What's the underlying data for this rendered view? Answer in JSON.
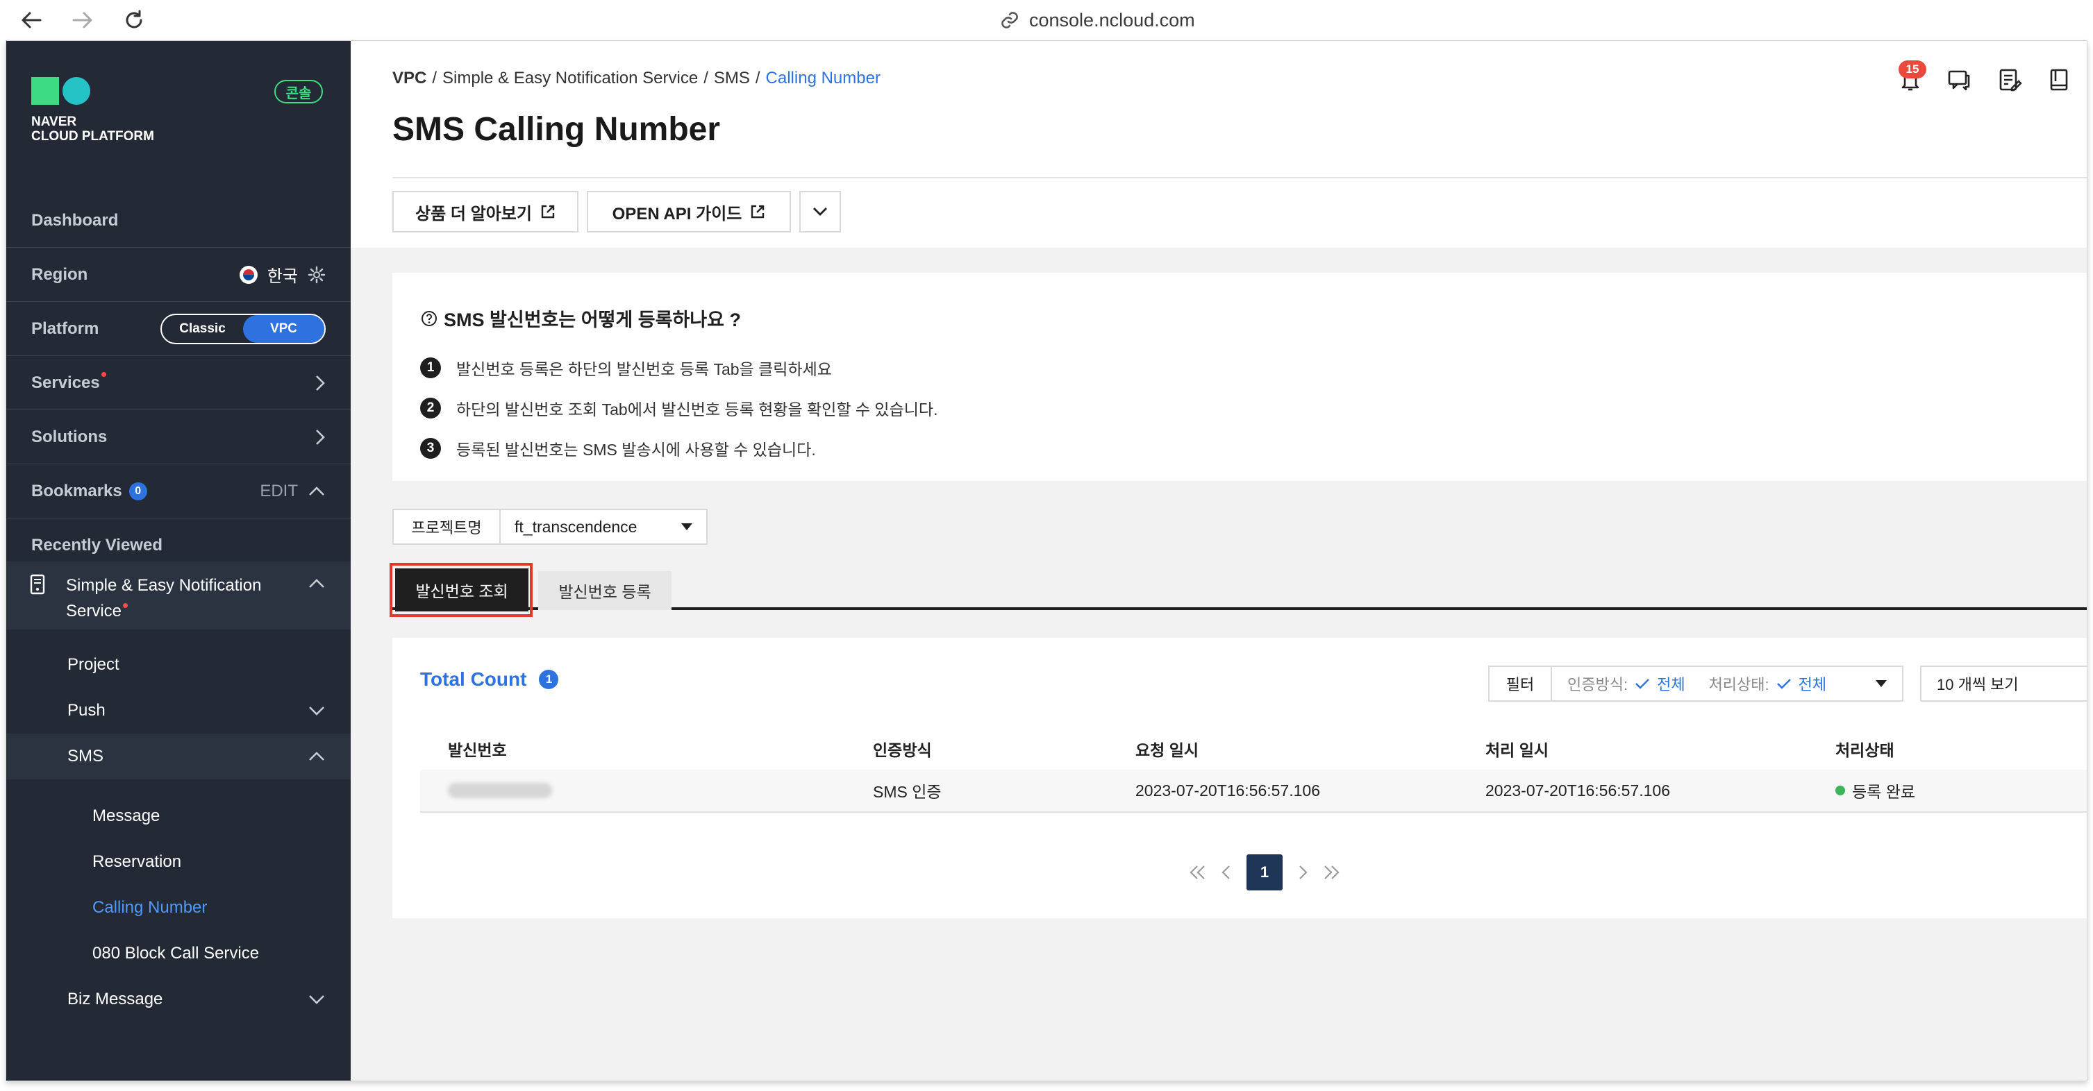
{
  "browser": {
    "url": "console.ncloud.com"
  },
  "sidebar": {
    "logo_text": "NAVER\nCLOUD PLATFORM",
    "console_badge": "콘솔",
    "dashboard": "Dashboard",
    "region_label": "Region",
    "region_value": "한국",
    "platform_label": "Platform",
    "platform_classic": "Classic",
    "platform_vpc": "VPC",
    "services": "Services",
    "solutions": "Solutions",
    "bookmarks": "Bookmarks",
    "bookmarks_count": "0",
    "bookmarks_edit": "EDIT",
    "recently_viewed": "Recently Viewed",
    "service_name": "Simple & Easy Notification Service",
    "items": {
      "project": "Project",
      "push": "Push",
      "sms": "SMS",
      "message": "Message",
      "reservation": "Reservation",
      "calling_number": "Calling Number",
      "block_call": "080 Block Call Service",
      "biz_message": "Biz Message"
    }
  },
  "breadcrumb": {
    "vpc": "VPC",
    "service": "Simple & Easy Notification Service",
    "sms": "SMS",
    "current": "Calling Number",
    "sep": "/"
  },
  "page_title": "SMS Calling Number",
  "header_buttons": {
    "learn_more": "상품 더 알아보기",
    "api_guide": "OPEN API 가이드"
  },
  "notifications": {
    "count": "15"
  },
  "info": {
    "title": "SMS 발신번호는 어떻게 등록하나요 ?",
    "steps": [
      {
        "num": "1",
        "text": "발신번호 등록은 하단의 발신번호 등록 Tab을 클릭하세요"
      },
      {
        "num": "2",
        "text": "하단의 발신번호 조회 Tab에서 발신번호 등록 현황을 확인할 수 있습니다."
      },
      {
        "num": "3",
        "text": "등록된 발신번호는 SMS 발송시에 사용할 수 있습니다."
      }
    ]
  },
  "project": {
    "label": "프로젝트명",
    "value": "ft_transcendence"
  },
  "tabs": {
    "lookup": "발신번호 조회",
    "register": "발신번호 등록"
  },
  "table": {
    "total_label": "Total Count",
    "total_count": "1",
    "filter_label": "필터",
    "filter_auth_label": "인증방식:",
    "filter_auth_value": "전체",
    "filter_status_label": "처리상태:",
    "filter_status_value": "전체",
    "per_page": "10 개씩 보기",
    "columns": [
      "발신번호",
      "인증방식",
      "요청 일시",
      "처리 일시",
      "처리상태"
    ],
    "rows": [
      {
        "auth": "SMS 인증",
        "requested": "2023-07-20T16:56:57.106",
        "processed": "2023-07-20T16:56:57.106",
        "status": "등록 완료"
      }
    ],
    "page": "1"
  },
  "colors": {
    "accent": "#2e72e0",
    "sidebar_bg": "#232a36",
    "highlight": "#e23a2a",
    "status_ok": "#3cb45a"
  }
}
